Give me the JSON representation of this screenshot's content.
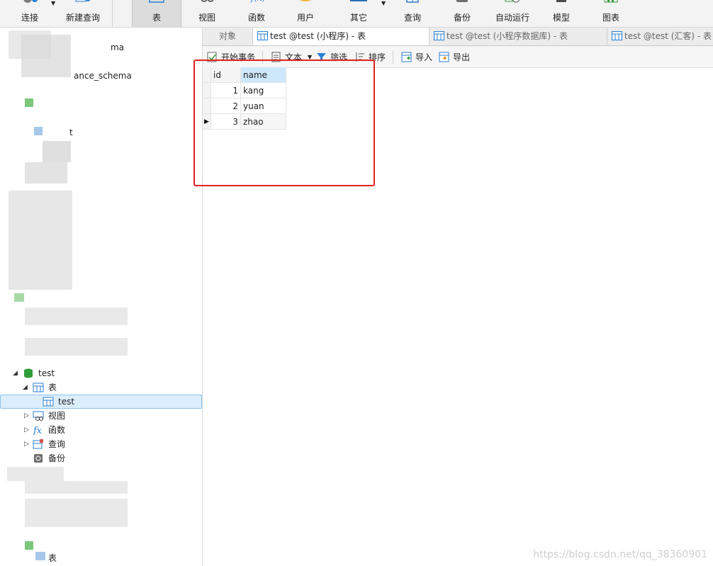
{
  "toolbar": {
    "buttons": [
      {
        "label": "连接",
        "icon": "connect-icon"
      },
      {
        "label": "新建查询",
        "icon": "new-query-icon"
      },
      {
        "label": "表",
        "icon": "table-icon",
        "active": true
      },
      {
        "label": "视图",
        "icon": "view-icon"
      },
      {
        "label": "函数",
        "icon": "function-icon"
      },
      {
        "label": "用户",
        "icon": "user-icon"
      },
      {
        "label": "其它",
        "icon": "other-icon"
      },
      {
        "label": "查询",
        "icon": "query-icon"
      },
      {
        "label": "备份",
        "icon": "backup-icon"
      },
      {
        "label": "自动运行",
        "icon": "auto-run-icon"
      },
      {
        "label": "模型",
        "icon": "model-icon"
      },
      {
        "label": "图表",
        "icon": "chart-icon"
      }
    ]
  },
  "sidebar": {
    "partial": [
      "ma",
      "ance_schema",
      "t"
    ],
    "tree": {
      "db": "test",
      "tables_group": "表",
      "selected_table": "test",
      "views": "视图",
      "functions": "函数",
      "queries": "查询",
      "backup": "备份",
      "bottom_tables": "表"
    }
  },
  "tabs": {
    "objects": "对象",
    "items": [
      {
        "label": "test @test (小程序) - 表",
        "active": true
      },
      {
        "label": "test @test (小程序数据库) - 表"
      },
      {
        "label": "test @test (汇客) - 表"
      }
    ]
  },
  "actions": {
    "begin_transaction": "开始事务",
    "text": "文本",
    "filter": "筛选",
    "sort": "排序",
    "import": "导入",
    "export": "导出"
  },
  "grid": {
    "columns": [
      "id",
      "name"
    ],
    "rows": [
      {
        "id": "1",
        "name": "kang"
      },
      {
        "id": "2",
        "name": "yuan"
      },
      {
        "id": "3",
        "name": "zhao"
      }
    ]
  },
  "watermark": "https://blog.csdn.net/qq_38360901",
  "colors": {
    "accent": "#2a7fd4",
    "highlight": "#e02020",
    "selection": "#dceefc"
  }
}
